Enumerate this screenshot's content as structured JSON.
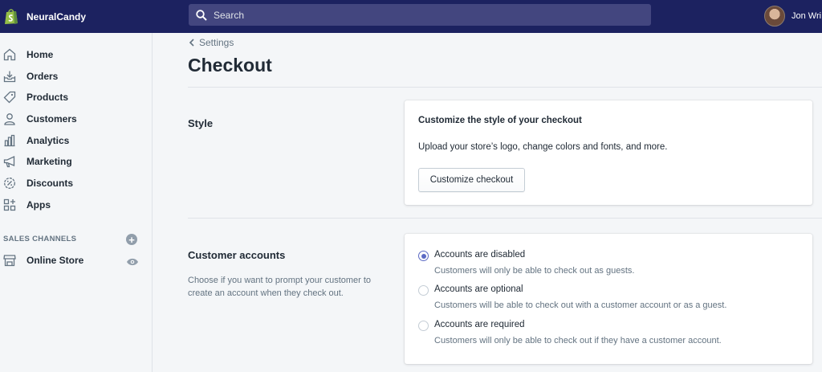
{
  "topbar": {
    "store_name": "NeuralCandy",
    "search_placeholder": "Search",
    "user_name": "Jon Wri"
  },
  "sidebar": {
    "items": [
      {
        "label": "Home",
        "icon": "home-icon"
      },
      {
        "label": "Orders",
        "icon": "orders-icon"
      },
      {
        "label": "Products",
        "icon": "tag-icon"
      },
      {
        "label": "Customers",
        "icon": "person-icon"
      },
      {
        "label": "Analytics",
        "icon": "bar-chart-icon"
      },
      {
        "label": "Marketing",
        "icon": "megaphone-icon"
      },
      {
        "label": "Discounts",
        "icon": "discount-icon"
      },
      {
        "label": "Apps",
        "icon": "apps-icon"
      }
    ],
    "sales_channels_header": "SALES CHANNELS",
    "channels": [
      {
        "label": "Online Store",
        "icon": "store-icon"
      }
    ]
  },
  "main": {
    "breadcrumb": "Settings",
    "title": "Checkout",
    "style_section": {
      "title": "Style",
      "card_title": "Customize the style of your checkout",
      "card_text": "Upload your store’s logo, change colors and fonts, and more.",
      "button_label": "Customize checkout"
    },
    "accounts_section": {
      "title": "Customer accounts",
      "description": "Choose if you want to prompt your customer to create an account when they check out.",
      "options": [
        {
          "label": "Accounts are disabled",
          "help": "Customers will only be able to check out as guests.",
          "checked": true
        },
        {
          "label": "Accounts are optional",
          "help": "Customers will be able to check out with a customer account or as a guest.",
          "checked": false
        },
        {
          "label": "Accounts are required",
          "help": "Customers will only be able to check out if they have a customer account.",
          "checked": false
        }
      ]
    }
  },
  "colors": {
    "topbar": "#1c2260",
    "search_bg": "#43467f",
    "accent": "#5c6ac4",
    "brand_green": "#95bf47"
  }
}
